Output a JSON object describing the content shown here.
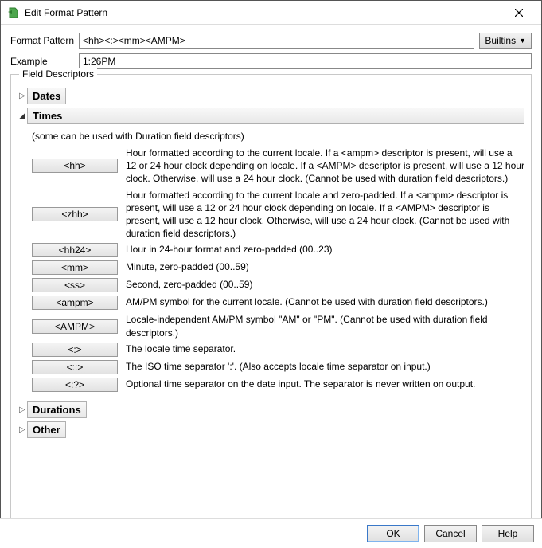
{
  "window": {
    "title": "Edit Format Pattern"
  },
  "labels": {
    "format_pattern": "Format Pattern",
    "example": "Example",
    "builtins": "Builtins",
    "field_descriptors": "Field Descriptors"
  },
  "values": {
    "format_pattern": "<hh><:><mm><AMPM>",
    "example": "1:26PM"
  },
  "sections": {
    "dates": {
      "title": "Dates"
    },
    "times": {
      "title": "Times",
      "note": "(some can be used with Duration field descriptors)",
      "items": [
        {
          "token": "<hh>",
          "desc": "Hour formatted according to the current locale. If a <ampm> descriptor is present, will use a 12 or 24 hour clock depending on locale. If a <AMPM> descriptor is present, will use a 12 hour clock. Otherwise, will use a 24 hour clock. (Cannot be used with duration field descriptors.)"
        },
        {
          "token": "<zhh>",
          "desc": "Hour formatted according to the current locale and zero-padded. If a <ampm> descriptor is present, will use a 12 or 24 hour clock depending on locale. If a <AMPM> descriptor is present, will use a 12 hour clock. Otherwise, will use a 24 hour clock. (Cannot be used with duration field descriptors.)"
        },
        {
          "token": "<hh24>",
          "desc": "Hour in 24-hour format and zero-padded (00..23)"
        },
        {
          "token": "<mm>",
          "desc": "Minute, zero-padded (00..59)"
        },
        {
          "token": "<ss>",
          "desc": "Second, zero-padded (00..59)"
        },
        {
          "token": "<ampm>",
          "desc": "AM/PM symbol for the current locale. (Cannot be used with duration field descriptors.)"
        },
        {
          "token": "<AMPM>",
          "desc": "Locale-independent AM/PM symbol \"AM\" or \"PM\". (Cannot be used with duration field descriptors.)"
        },
        {
          "token": "<:>",
          "desc": "The locale time separator."
        },
        {
          "token": "<::>",
          "desc": "The ISO time separator ':'. (Also accepts locale time separator on input.)"
        },
        {
          "token": "<:?>",
          "desc": "Optional time separator on the date input. The separator is never written on output."
        }
      ]
    },
    "durations": {
      "title": "Durations"
    },
    "other": {
      "title": "Other"
    }
  },
  "buttons": {
    "ok": "OK",
    "cancel": "Cancel",
    "help": "Help"
  }
}
